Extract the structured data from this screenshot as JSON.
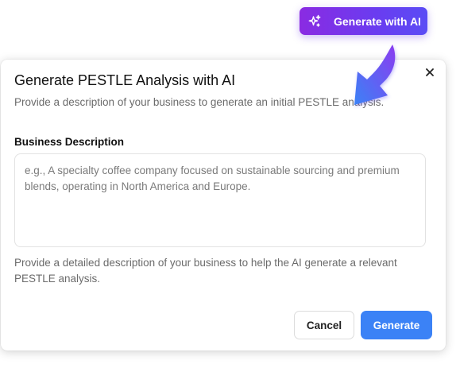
{
  "header": {
    "generate_ai_label": "Generate with AI",
    "generate_ai_icon": "sparkles-icon"
  },
  "dialog": {
    "title": "Generate PESTLE Analysis with AI",
    "subtitle": "Provide a description of your business to generate an initial PESTLE analysis.",
    "close_icon": "close-icon",
    "field_label": "Business Description",
    "textarea": {
      "value": "",
      "placeholder": "e.g., A specialty coffee company focused on sustainable sourcing and premium blends, operating in North America and Europe."
    },
    "helper_text": "Provide a detailed description of your business to help the AI generate a relevant PESTLE analysis.",
    "cancel_label": "Cancel",
    "generate_label": "Generate"
  },
  "colors": {
    "ai_button_gradient_start": "#8a2be2",
    "ai_button_gradient_end": "#5a4cf5",
    "primary": "#3b82f6",
    "arrow_gradient_start": "#8b3cf0",
    "arrow_gradient_end": "#3b82f6"
  }
}
